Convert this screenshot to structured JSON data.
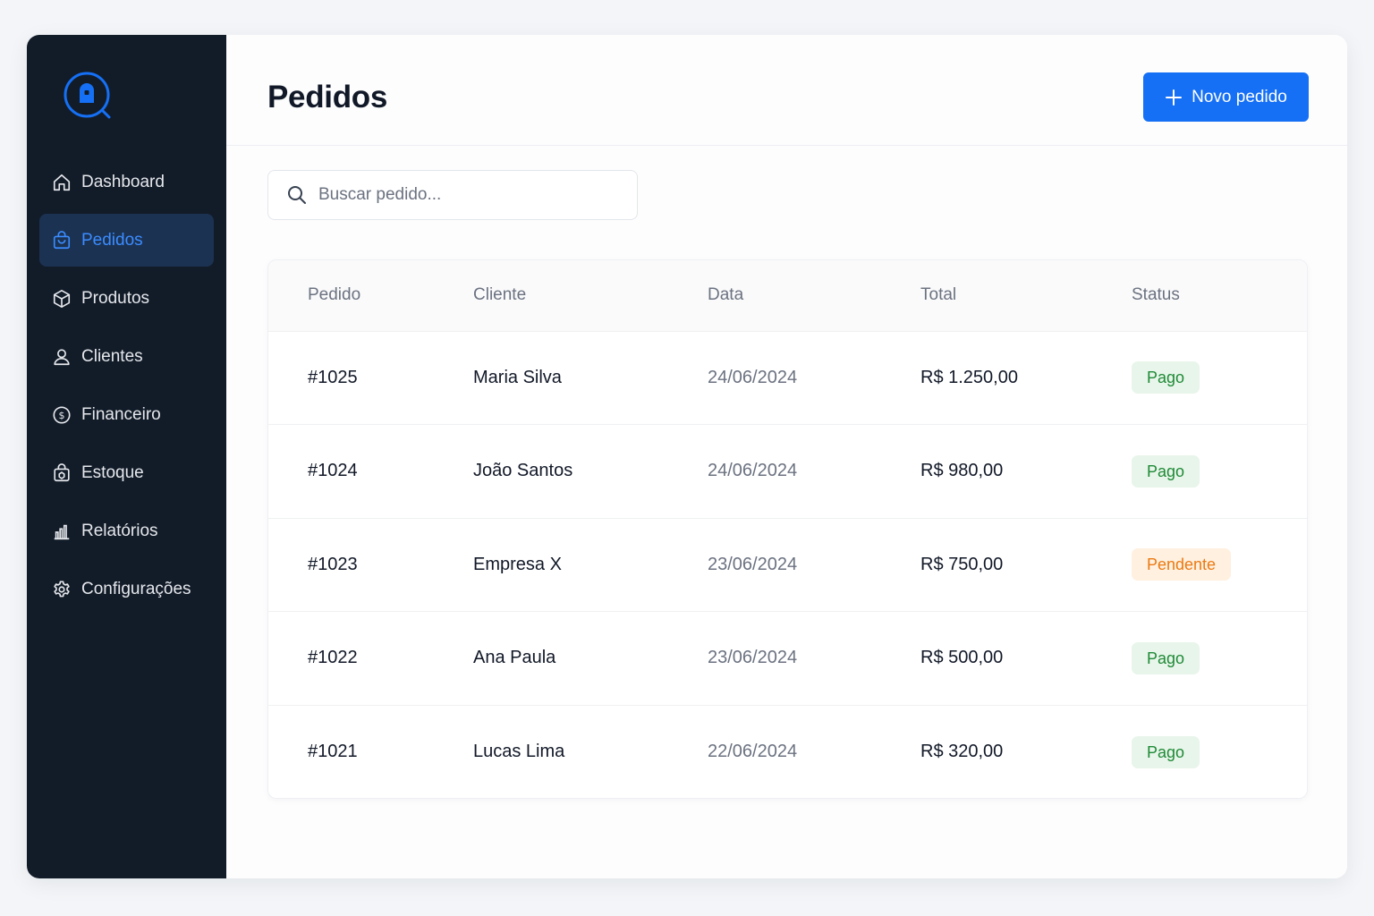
{
  "sidebar": {
    "items": [
      {
        "label": "Dashboard",
        "icon": "home-icon",
        "active": false
      },
      {
        "label": "Pedidos",
        "icon": "shopping-bag-icon",
        "active": true
      },
      {
        "label": "Produtos",
        "icon": "box-icon",
        "active": false
      },
      {
        "label": "Clientes",
        "icon": "user-icon",
        "active": false
      },
      {
        "label": "Financeiro",
        "icon": "dollar-circle-icon",
        "active": false
      },
      {
        "label": "Estoque",
        "icon": "inventory-bag-icon",
        "active": false
      },
      {
        "label": "Relatórios",
        "icon": "bar-chart-icon",
        "active": false
      },
      {
        "label": "Configurações",
        "icon": "gear-icon",
        "active": false
      }
    ]
  },
  "header": {
    "title": "Pedidos",
    "new_button_label": "Novo pedido"
  },
  "search": {
    "placeholder": "Buscar pedido...",
    "value": ""
  },
  "table": {
    "columns": [
      "Pedido",
      "Cliente",
      "Data",
      "Total",
      "Status"
    ],
    "rows": [
      {
        "id": "#1025",
        "client": "Maria Silva",
        "date": "24/06/2024",
        "total": "R$ 1.250,00",
        "status": "Pago"
      },
      {
        "id": "#1024",
        "client": "João Santos",
        "date": "24/06/2024",
        "total": "R$ 980,00",
        "status": "Pago"
      },
      {
        "id": "#1023",
        "client": "Empresa X",
        "date": "23/06/2024",
        "total": "R$ 750,00",
        "status": "Pendente"
      },
      {
        "id": "#1022",
        "client": "Ana Paula",
        "date": "23/06/2024",
        "total": "R$ 500,00",
        "status": "Pago"
      },
      {
        "id": "#1021",
        "client": "Lucas Lima",
        "date": "22/06/2024",
        "total": "R$ 320,00",
        "status": "Pago"
      }
    ]
  },
  "colors": {
    "sidebar_bg": "#121c29",
    "accent": "#1570f5",
    "active_nav_bg": "#1b3252",
    "paid_text": "#1f8a37",
    "paid_bg": "#e8f5ea",
    "pending_text": "#ea7a12",
    "pending_bg": "#fff0e0"
  }
}
